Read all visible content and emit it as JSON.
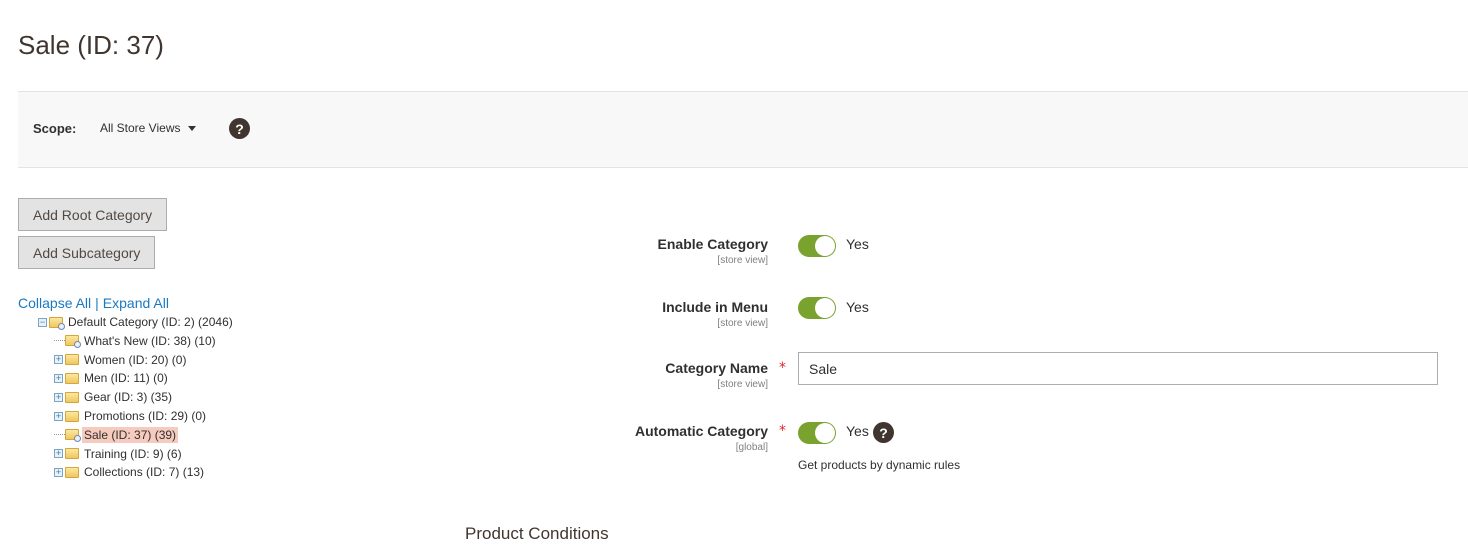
{
  "page": {
    "title": "Sale (ID: 37)"
  },
  "scope": {
    "label": "Scope:",
    "value": "All Store Views",
    "help_icon": "question-icon"
  },
  "buttons": {
    "add_root": "Add Root Category",
    "add_sub": "Add Subcategory"
  },
  "tree_controls": {
    "collapse": "Collapse All",
    "separator": "|",
    "expand": "Expand All"
  },
  "tree": [
    {
      "label": "Default Category (ID: 2) (2046)",
      "level": 0,
      "toggle": "−"
    },
    {
      "label": "What's New (ID: 38) (10)",
      "level": 1,
      "toggle": ""
    },
    {
      "label": "Women (ID: 20) (0)",
      "level": 1,
      "toggle": "+"
    },
    {
      "label": "Men (ID: 11) (0)",
      "level": 1,
      "toggle": "+"
    },
    {
      "label": "Gear (ID: 3) (35)",
      "level": 1,
      "toggle": "+"
    },
    {
      "label": "Promotions (ID: 29) (0)",
      "level": 1,
      "toggle": "+"
    },
    {
      "label": "Sale (ID: 37) (39)",
      "level": 1,
      "toggle": "",
      "selected": true
    },
    {
      "label": "Training (ID: 9) (6)",
      "level": 1,
      "toggle": "+"
    },
    {
      "label": "Collections (ID: 7) (13)",
      "level": 1,
      "toggle": "+"
    }
  ],
  "form": {
    "enable": {
      "label": "Enable Category",
      "scope": "[store view]",
      "value": "Yes",
      "on": true
    },
    "menu": {
      "label": "Include in Menu",
      "scope": "[store view]",
      "value": "Yes",
      "on": true
    },
    "name": {
      "label": "Category Name",
      "scope": "[store view]",
      "required": "*",
      "value": "Sale"
    },
    "automatic": {
      "label": "Automatic Category",
      "scope": "[global]",
      "required": "*",
      "value": "Yes",
      "on": true,
      "note": "Get products by dynamic rules"
    }
  },
  "section": {
    "title": "Product Conditions"
  },
  "colors": {
    "toggle_on": "#79a22e",
    "link": "#1979c3",
    "selected": "#f6cbbd",
    "required": "#e22626"
  }
}
